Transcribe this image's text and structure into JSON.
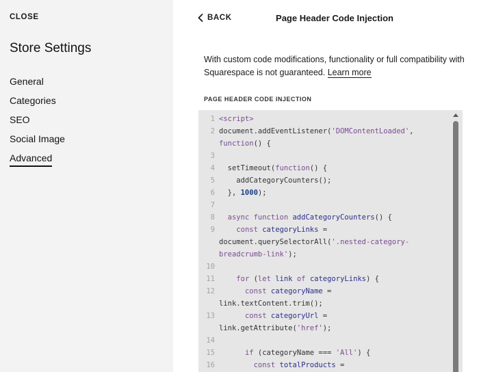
{
  "sidebar": {
    "close_label": "CLOSE",
    "title": "Store Settings",
    "items": [
      {
        "label": "General",
        "active": false
      },
      {
        "label": "Categories",
        "active": false
      },
      {
        "label": "SEO",
        "active": false
      },
      {
        "label": "Social Image",
        "active": false
      },
      {
        "label": "Advanced",
        "active": true
      }
    ]
  },
  "header": {
    "back_label": "BACK",
    "title": "Page Header Code Injection"
  },
  "notice": {
    "line1": "With custom code modifications, functionality or full compatibility with",
    "line2_prefix": "Squarespace is not guaranteed. ",
    "learn_more": "Learn more"
  },
  "section_label": "PAGE HEADER CODE INJECTION",
  "code_lines": [
    {
      "n": "1",
      "tokens": [
        [
          "t-tag",
          "<script>"
        ]
      ]
    },
    {
      "n": "2",
      "tokens": [
        [
          "",
          "document.addEventListener("
        ],
        [
          "t-str",
          "'DOMContentLoaded'"
        ],
        [
          "",
          ","
        ]
      ]
    },
    {
      "n": "",
      "tokens": [
        [
          "t-kw",
          "function"
        ],
        [
          "",
          "() {"
        ]
      ]
    },
    {
      "n": "3",
      "tokens": []
    },
    {
      "n": "4",
      "tokens": [
        [
          "",
          "  setTimeout("
        ],
        [
          "t-kw",
          "function"
        ],
        [
          "",
          "() {"
        ]
      ]
    },
    {
      "n": "5",
      "tokens": [
        [
          "",
          "    addCategoryCounters();"
        ]
      ]
    },
    {
      "n": "6",
      "tokens": [
        [
          "",
          "  }, "
        ],
        [
          "t-num",
          "1000"
        ],
        [
          "",
          ");"
        ]
      ]
    },
    {
      "n": "7",
      "tokens": []
    },
    {
      "n": "8",
      "tokens": [
        [
          "",
          "  "
        ],
        [
          "t-kw",
          "async function "
        ],
        [
          "t-fn",
          "addCategoryCounters"
        ],
        [
          "",
          "() {"
        ]
      ]
    },
    {
      "n": "9",
      "tokens": [
        [
          "",
          "    "
        ],
        [
          "t-kw",
          "const "
        ],
        [
          "t-var",
          "categoryLinks"
        ],
        [
          "",
          " ="
        ]
      ]
    },
    {
      "n": "",
      "tokens": [
        [
          "",
          "document.querySelectorAll("
        ],
        [
          "t-str",
          "'.nested-category-"
        ]
      ]
    },
    {
      "n": "",
      "tokens": [
        [
          "t-str",
          "breadcrumb-link'"
        ],
        [
          "",
          ");"
        ]
      ]
    },
    {
      "n": "10",
      "tokens": []
    },
    {
      "n": "11",
      "tokens": [
        [
          "",
          "    "
        ],
        [
          "t-kw",
          "for "
        ],
        [
          "",
          "("
        ],
        [
          "t-kw",
          "let "
        ],
        [
          "t-var",
          "link"
        ],
        [
          "t-kw",
          " of "
        ],
        [
          "t-var",
          "categoryLinks"
        ],
        [
          "",
          ") {"
        ]
      ]
    },
    {
      "n": "12",
      "tokens": [
        [
          "",
          "      "
        ],
        [
          "t-kw",
          "const "
        ],
        [
          "t-var",
          "categoryName"
        ],
        [
          "",
          " ="
        ]
      ]
    },
    {
      "n": "",
      "tokens": [
        [
          "",
          "link.textContent.trim();"
        ]
      ]
    },
    {
      "n": "13",
      "tokens": [
        [
          "",
          "      "
        ],
        [
          "t-kw",
          "const "
        ],
        [
          "t-var",
          "categoryUrl"
        ],
        [
          "",
          " ="
        ]
      ]
    },
    {
      "n": "",
      "tokens": [
        [
          "",
          "link.getAttribute("
        ],
        [
          "t-str",
          "'href'"
        ],
        [
          "",
          ");"
        ]
      ]
    },
    {
      "n": "14",
      "tokens": []
    },
    {
      "n": "15",
      "tokens": [
        [
          "",
          "      "
        ],
        [
          "t-kw",
          "if "
        ],
        [
          "",
          "(categoryName === "
        ],
        [
          "t-str",
          "'All'"
        ],
        [
          "",
          ") {"
        ]
      ]
    },
    {
      "n": "16",
      "tokens": [
        [
          "",
          "        "
        ],
        [
          "t-kw",
          "const "
        ],
        [
          "t-var",
          "totalProducts"
        ],
        [
          "",
          " ="
        ]
      ]
    }
  ]
}
